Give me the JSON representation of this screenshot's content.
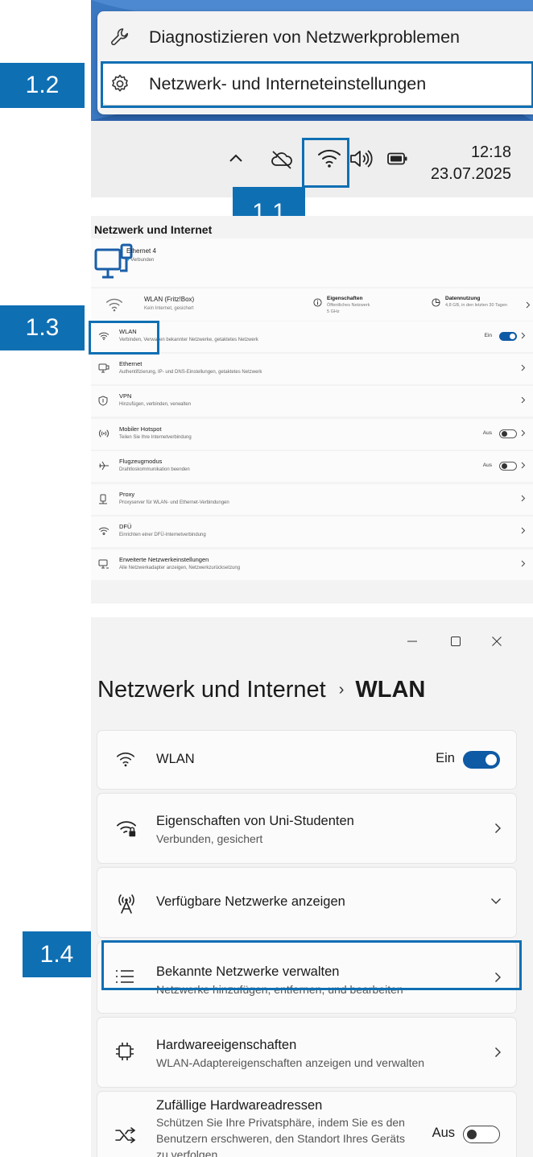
{
  "steps": {
    "s1_1": "1.1",
    "s1_2": "1.2",
    "s1_3": "1.3",
    "s1_4": "1.4"
  },
  "context_menu": {
    "items": [
      {
        "label": "Diagnostizieren von Netzwerkproblemen",
        "icon": "wrench-icon"
      },
      {
        "label": "Netzwerk- und Interneteinstellungen",
        "icon": "gear-icon"
      }
    ]
  },
  "taskbar": {
    "time": "12:18",
    "date": "23.07.2025",
    "icons": [
      "chevron-up-icon",
      "cloud-offline-icon",
      "wifi-icon",
      "speaker-icon",
      "battery-icon"
    ]
  },
  "settings": {
    "title": "Netzwerk und Internet",
    "ethernet_header": {
      "name": "Ethernet 4",
      "status": "Verbunden"
    },
    "wifi_summary": {
      "name": "WLAN  (Fritz!Box)",
      "status": "Kein Internet, gesichert",
      "props_title": "Eigenschaften",
      "props_sub1": "Öffentliches Netzwerk",
      "props_sub2": "5 GHz",
      "usage_title": "Datennutzung",
      "usage_sub": "4,8 GB, in den letzten 30 Tagen"
    },
    "rows": [
      {
        "title": "WLAN",
        "subtitle": "Verbinden, Verwalten bekannter Netzwerke, getaktetes Netzwerk",
        "state": "Ein",
        "toggle": "on",
        "icon": "wifi-icon"
      },
      {
        "title": "Ethernet",
        "subtitle": "Authentifizierung, IP- und DNS-Einstellungen, getaktetes Netzwerk",
        "state": "",
        "toggle": "",
        "icon": "ethernet-icon"
      },
      {
        "title": "VPN",
        "subtitle": "Hinzufügen, verbinden, verwalten",
        "state": "",
        "toggle": "",
        "icon": "vpn-shield-icon"
      },
      {
        "title": "Mobiler Hotspot",
        "subtitle": "Teilen Sie Ihre Internetverbindung",
        "state": "Aus",
        "toggle": "off",
        "icon": "hotspot-icon"
      },
      {
        "title": "Flugzeugmodus",
        "subtitle": "Drahtloskommunikation beenden",
        "state": "Aus",
        "toggle": "off",
        "icon": "airplane-icon"
      },
      {
        "title": "Proxy",
        "subtitle": "Proxyserver für WLAN- und Ethernet-Verbindungen",
        "state": "",
        "toggle": "",
        "icon": "proxy-icon"
      },
      {
        "title": "DFÜ",
        "subtitle": "Einrichten einer DFÜ-Internetverbindung",
        "state": "",
        "toggle": "",
        "icon": "dialup-icon"
      },
      {
        "title": "Erweiterte Netzwerkeinstellungen",
        "subtitle": "Alle Netzwerkadapter anzeigen, Netzwerkzurücksetzung",
        "state": "",
        "toggle": "",
        "icon": "advanced-network-icon"
      }
    ]
  },
  "wlan_page": {
    "window_controls": [
      "minimize-icon",
      "maximize-icon",
      "close-icon"
    ],
    "breadcrumb_parent": "Netzwerk und Internet",
    "breadcrumb_separator": "›",
    "breadcrumb_current": "WLAN",
    "wlan_row": {
      "label": "WLAN",
      "state": "Ein"
    },
    "properties": {
      "title": "Eigenschaften von Uni-Studenten",
      "subtitle": "Verbunden, gesichert"
    },
    "available": {
      "title": "Verfügbare Netzwerke anzeigen"
    },
    "known": {
      "title": "Bekannte Netzwerke verwalten",
      "subtitle": "Netzwerke hinzufügen, entfernen, und bearbeiten"
    },
    "hardware": {
      "title": "Hardwareeigenschaften",
      "subtitle": "WLAN-Adaptereigenschaften anzeigen und verwalten"
    },
    "random": {
      "title": "Zufällige Hardwareadressen",
      "line1": "Schützen Sie Ihre Privatsphäre, indem Sie es den",
      "line2": "Benutzern erschweren, den Standort Ihres Geräts",
      "line3": "zu verfolgen.",
      "state": "Aus"
    }
  },
  "colors": {
    "accent": "#0f6fb3",
    "toggle_on": "#0f5aa5",
    "wallpaper": "#3a79c4"
  }
}
